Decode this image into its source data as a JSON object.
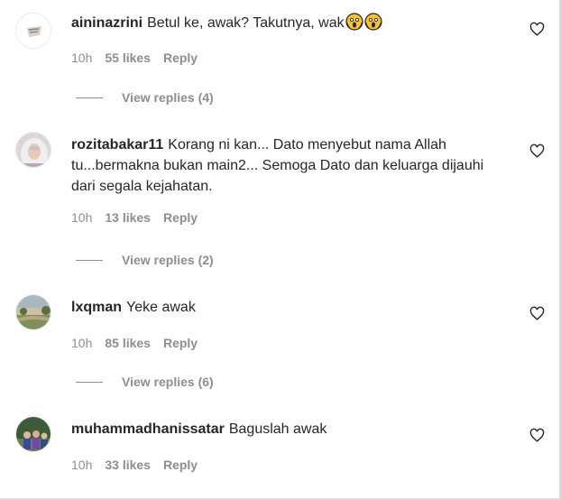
{
  "comments": [
    {
      "username": "aininazrini",
      "text": "Betul ke, awak? Takutnya, wak",
      "emojis": [
        "face-screaming-in-fear",
        "face-screaming-in-fear"
      ],
      "time": "10h",
      "likes": "55 likes",
      "reply": "Reply",
      "view_replies": "View replies (4)",
      "avatar_icon": "avatar-logo-icon"
    },
    {
      "username": "rozitabakar11",
      "text": "Korang ni kan... Dato menyebut nama Allah tu...bermakna bukan main2... Semoga Dato dan keluarga dijauhi dari segala kejahatan.",
      "time": "10h",
      "likes": "13 likes",
      "reply": "Reply",
      "view_replies": "View replies (2)",
      "avatar_icon": "avatar-hijab-icon"
    },
    {
      "username": "lxqman",
      "text": "Yeke awak",
      "time": "10h",
      "likes": "85 likes",
      "reply": "Reply",
      "view_replies": "View replies (6)",
      "avatar_icon": "avatar-landscape-icon"
    },
    {
      "username": "muhammadhanissatar",
      "text": "Baguslah awak",
      "time": "10h",
      "likes": "33 likes",
      "reply": "Reply",
      "avatar_icon": "avatar-group-icon"
    }
  ],
  "colors": {
    "text": "#262626",
    "muted": "#8e8e8e",
    "border": "#dbdbdb"
  }
}
